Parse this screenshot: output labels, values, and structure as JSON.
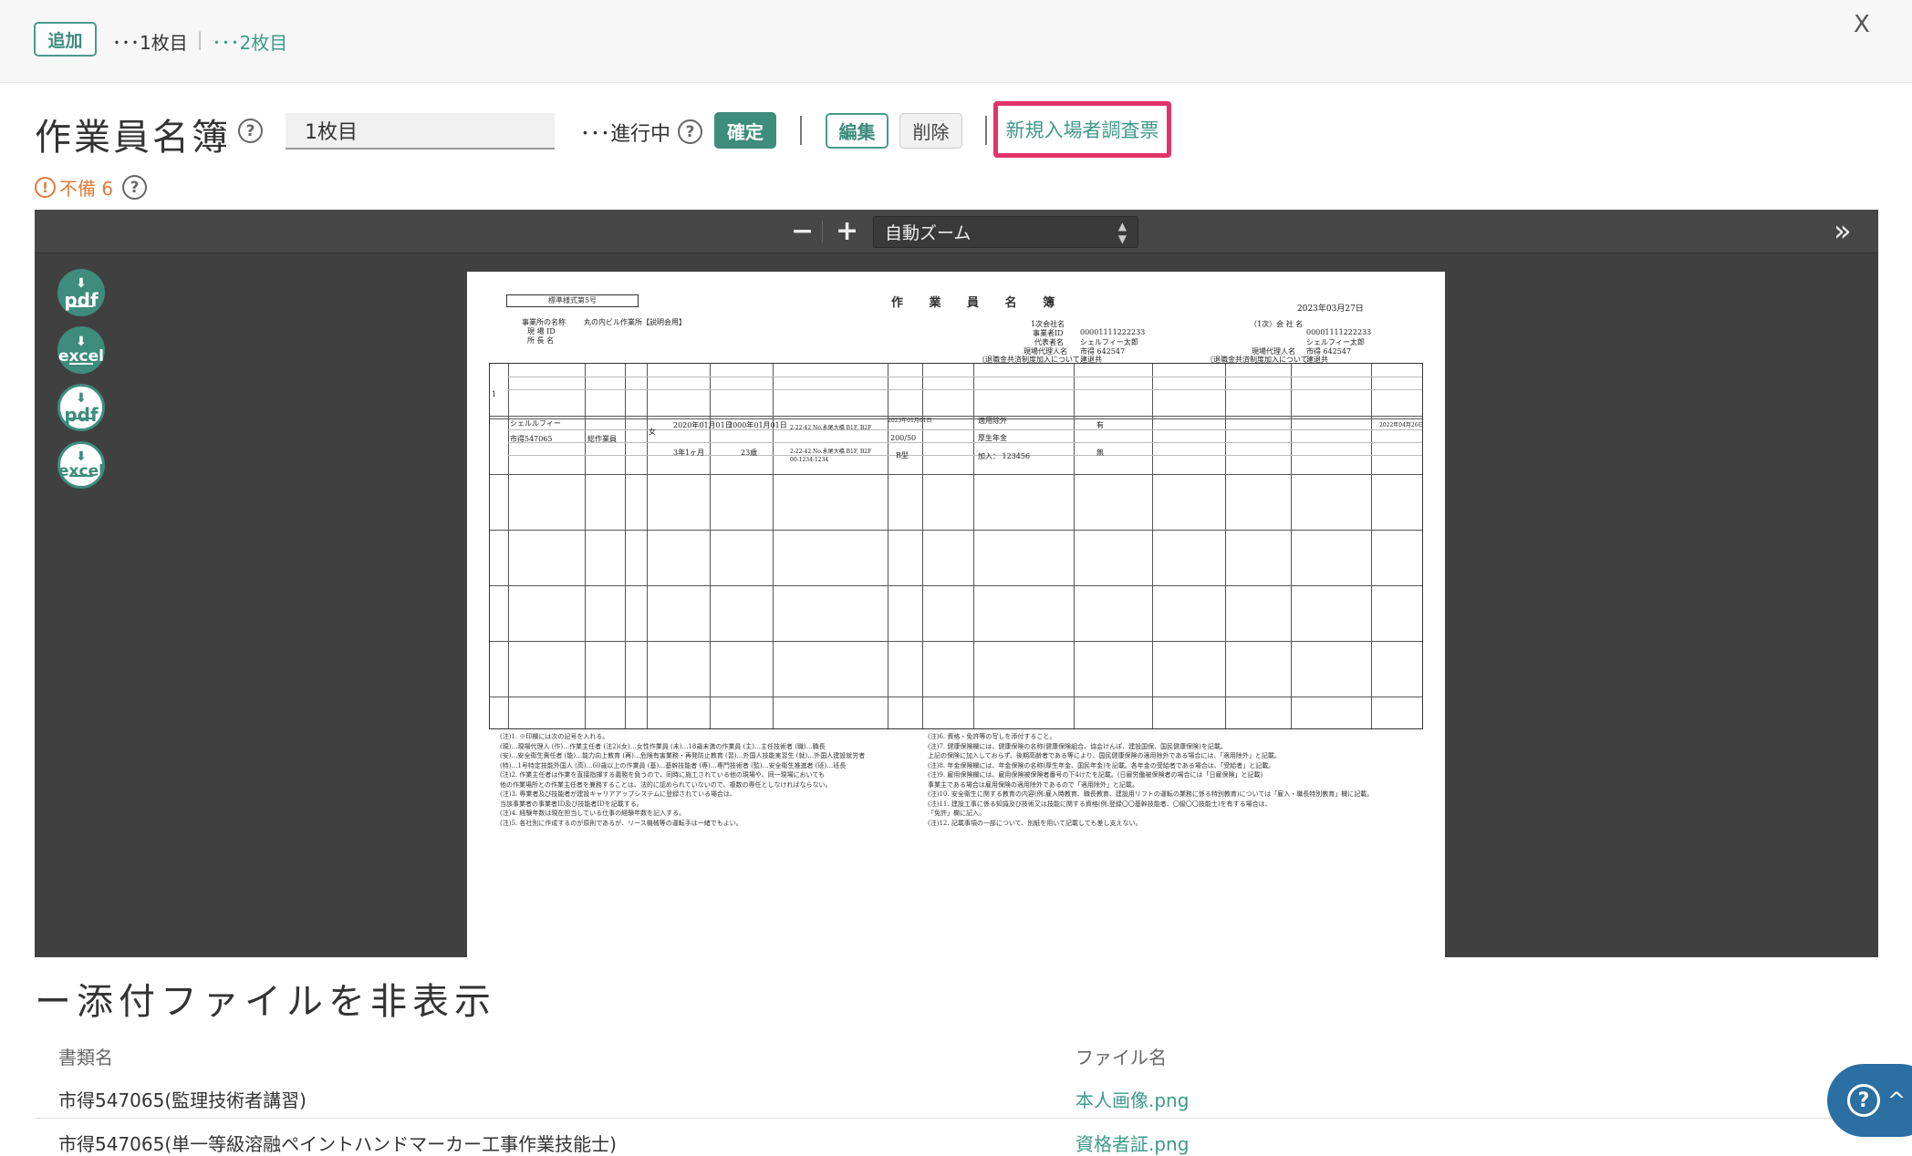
{
  "topbar": {
    "add_label": "追加",
    "tab1": "･･･1枚目",
    "tab2": "･･･2枚目",
    "close": "X"
  },
  "header": {
    "title": "作業員名簿",
    "sheet_name": "1枚目",
    "status": "･･･進行中",
    "confirm_label": "確定",
    "edit_label": "編集",
    "delete_label": "削除",
    "new_entry_label": "新規入場者調査票",
    "deficit_label": "不備 6"
  },
  "viewer": {
    "zoom_out": "−",
    "zoom_in": "+",
    "zoom_value": "自動ズーム",
    "expand": "»",
    "side_icons": [
      {
        "type": "pdf",
        "style": "filled",
        "label": "pdf"
      },
      {
        "type": "excel",
        "style": "filled",
        "label": "excel"
      },
      {
        "type": "pdf",
        "style": "outline",
        "label": "pdf"
      },
      {
        "type": "excel",
        "style": "outline",
        "label": "excel"
      }
    ],
    "document": {
      "form_no": "標準様式第5号",
      "title": "作 業 員 名 簿",
      "date": "2023年03月27日",
      "office_label": "事業所の名称",
      "office_value": "丸の内ビル作業所【説明会用】",
      "site_id_label": "現 場 ID",
      "site_name_label": "所 長 名",
      "primary_label": "1次会社名",
      "company_id_label": "事業者ID",
      "company_id": "00001111222233",
      "rep_label": "代表者名",
      "rep": "シェルフィー太郎",
      "agent_label": "現場代理人名",
      "agent": "市得 642547",
      "agent2_label": "現場代理人名",
      "agent2": "市得 642547",
      "secondary_label": "（1次）会 社 名",
      "company_id2": "00001111222233",
      "rep2": "シェルフィー太郎",
      "retire_fund": "〔退職金共済制度加入について",
      "retire_value": "建退共",
      "row1": {
        "no": "1",
        "kana": "シェルルフィー",
        "name": "市得547065",
        "role": "総作業員",
        "gender": "女",
        "hired": "2020年01月01日",
        "birth": "2000年01月01日",
        "years": "3年1ヶ月",
        "age": "23歳",
        "addr1": "2-22-42 No.永尾大橋 B1F, B2F",
        "addr2": "2-22-42 No.永尾大橋 B1F, B2F",
        "phone": "00-1234-1234",
        "date2": "2023年01月01日",
        "bp": "200/50",
        "blood": "B型",
        "insurance": "適用除外",
        "pension": "厚生年金",
        "join": "加入： 123456",
        "has": "有",
        "none": "無",
        "last": "2022年04月26日"
      },
      "notes_left": [
        "(注)1. ※印欄には次の記号を入れる。",
        "(現)…現場代理人 (作)…作業主任者 (注2)(女)…女性作業員 (未)…18歳未満の作業員 (主)…主任技術者 (職)…職長",
        "(安)…安全衛生責任者 (能)…能力向上教育 (再)…危険有害業務・再発防止教育 (習)…外国人技能実習生 (就)…外国人建設就労者",
        "(特)…1号特定技能外国人 (高)…60歳以上の作業員 (基)…基幹技能者 (専)…専門技術者 (監)…安全衛生推進者 (班)…班長",
        "(注)2. 作業主任者は作業を直接指揮する義務を負うので、同時に施工されている他の現場や、同一現場においても",
        "他の作業場所との作業主任者を兼務することは、法的に認められていないので、複数の専任としなければならない。",
        "(注)3. 専業者及び技能者が建設キャリアアップシステムに登録されている場合は、",
        "当該事業者の事業者ID及び技能者IDを記載する。",
        "(注)4. 経験年数は現在担当している仕事の経験年数を記入する。",
        "(注)5. 各社別に作成するのが原則であるが、リース機械等の運転手は一緒でもよい。"
      ],
      "notes_right": [
        "(注)6. 資格・免許等の写しを添付すること。",
        "(注)7. 健康保険欄には、健康保険の名称(健康保険組合、協会けんぽ、建設国保、国民健康保険)を記載。",
        "上記の保険に加入しておらず、後期高齢者である等により、国民健康保険の適用除外である場合には、「適用除外」と記載。",
        "(注)8. 年金保険欄には、年金保険の名称(厚生年金、国民年金)を記載。各年金の受給者である場合は、「受給者」と記載。",
        "(注)9. 雇用保険欄には、雇用保険被保険者番号の下4けたを記載。(日雇労働被保険者の場合には「日雇保険」と記載)",
        "事業主である場合は雇用保険の適用除外であるので「適用除外」と記載。",
        "(注)10. 安全衛生に関する教育の内容(例:雇入時教育、職長教育、建設用リフトの運転の業務に係る特別教育)については「雇入・職長特別教育」欄に記載。",
        "(注)11. 建設工事に係る知識及び技術又は技能に関する資格(例:登録〇〇基幹技能者、〇級〇〇技能士)を有する場合は、",
        "「免許」欄に記入。",
        "(注)12. 記載事項の一部について、別紙を用いて記載しても差し支えない。"
      ]
    }
  },
  "attachments": {
    "toggle_label": "ー添付ファイルを非表示",
    "col_doc": "書類名",
    "col_file": "ファイル名",
    "rows": [
      {
        "doc": "市得547065(監理技術者講習)",
        "file": "本人画像.png"
      },
      {
        "doc": "市得547065(単一等級溶融ペイントハンドマーカー工事作業技能士)",
        "file": "資格者証.png"
      }
    ]
  },
  "colors": {
    "accent": "#3d8c7c",
    "highlight": "#e2336b",
    "warning": "#e07a3a",
    "help": "#2b6fa3"
  }
}
